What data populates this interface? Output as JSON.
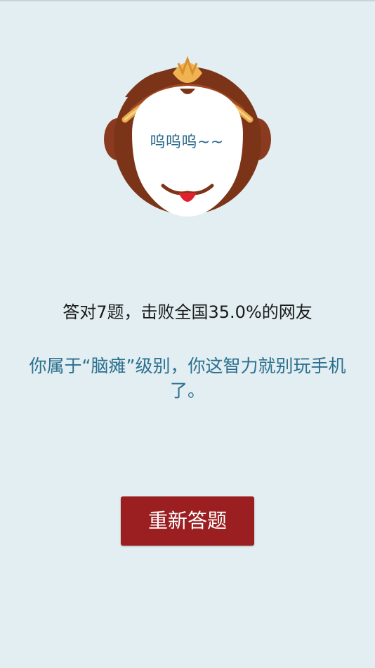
{
  "result": {
    "face_text": "呜呜呜~~",
    "score_line": "答对7题，击败全国35.0%的网友",
    "verdict": "你属于“脑瘫”级别，你这智力就别玩手机了。"
  },
  "actions": {
    "retry_label": "重新答题"
  },
  "colors": {
    "background": "#e2eef1",
    "button": "#9b1f21",
    "verdict_text": "#2b6f8f"
  },
  "icons": {
    "mascot": "monkey-face-icon"
  }
}
